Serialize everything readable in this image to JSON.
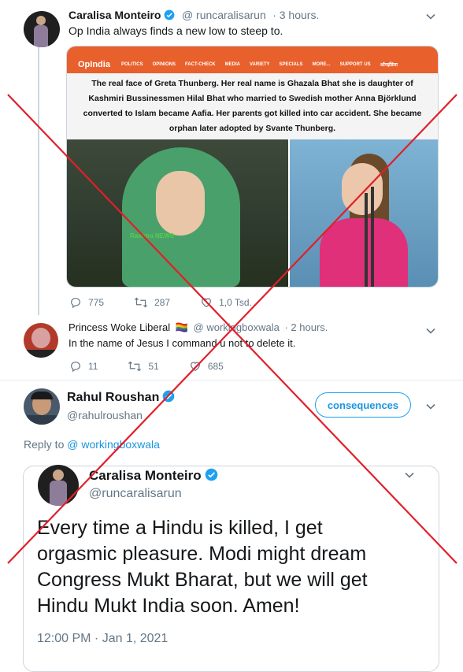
{
  "tweet1": {
    "name": "Caralisa Monteiro",
    "handle": "@ runcaralisarun",
    "time": "· 3 hours.",
    "text": "Op India always finds a new low to steep to.",
    "replies": "775",
    "retweets": "287",
    "likes": "1,0 Tsd."
  },
  "embed": {
    "logo": "OpIndia",
    "nav": [
      "POLITICS",
      "OPINIONS",
      "FACT-CHECK",
      "MEDIA",
      "VARIETY",
      "SPECIALS",
      "MORE...",
      "SUPPORT US",
      "ऑपइंडिया"
    ],
    "headline_lines": [
      "The real face of Greta Thunberg. Her real name is Ghazala Bhat she is daughter of",
      "Kashmiri Bussinessmen Hilal Bhat who married to Swedish mother Anna Björklund",
      "converted to Islam became Aafia. Her parents  got killed into car accident. She became",
      "orphan later adopted by Svante Thunberg."
    ],
    "watermark": "Rashtra NEWS"
  },
  "tweet2": {
    "name": "Princess Woke Liberal",
    "flag": "🏳️‍🌈",
    "handle": "@ workingboxwala",
    "time": "· 2 hours.",
    "text": "In the name of Jesus I command u not to delete it.",
    "replies": "11",
    "retweets": "51",
    "likes": "685"
  },
  "tweet3": {
    "name": "Rahul Roushan",
    "handle": "@rahulroushan",
    "button": "consequences",
    "reply_prefix": "Reply to",
    "reply_handle": "@ workingboxwala"
  },
  "quoted": {
    "name": "Caralisa Monteiro",
    "handle": "@runcaralisarun",
    "lines": [
      "Every time a Hindu is killed, I get",
      "orgasmic pleasure. Modi might dream",
      "Congress Mukt Bharat, but we will get",
      "Hindu Mukt India soon. Amen!"
    ],
    "timestamp": "12:00 PM · Jan 1, 2021"
  },
  "colors": {
    "accent": "#1da1f2",
    "verified": "#1da1f2",
    "cross": "#e0202a",
    "opindia": "#e8602c"
  }
}
